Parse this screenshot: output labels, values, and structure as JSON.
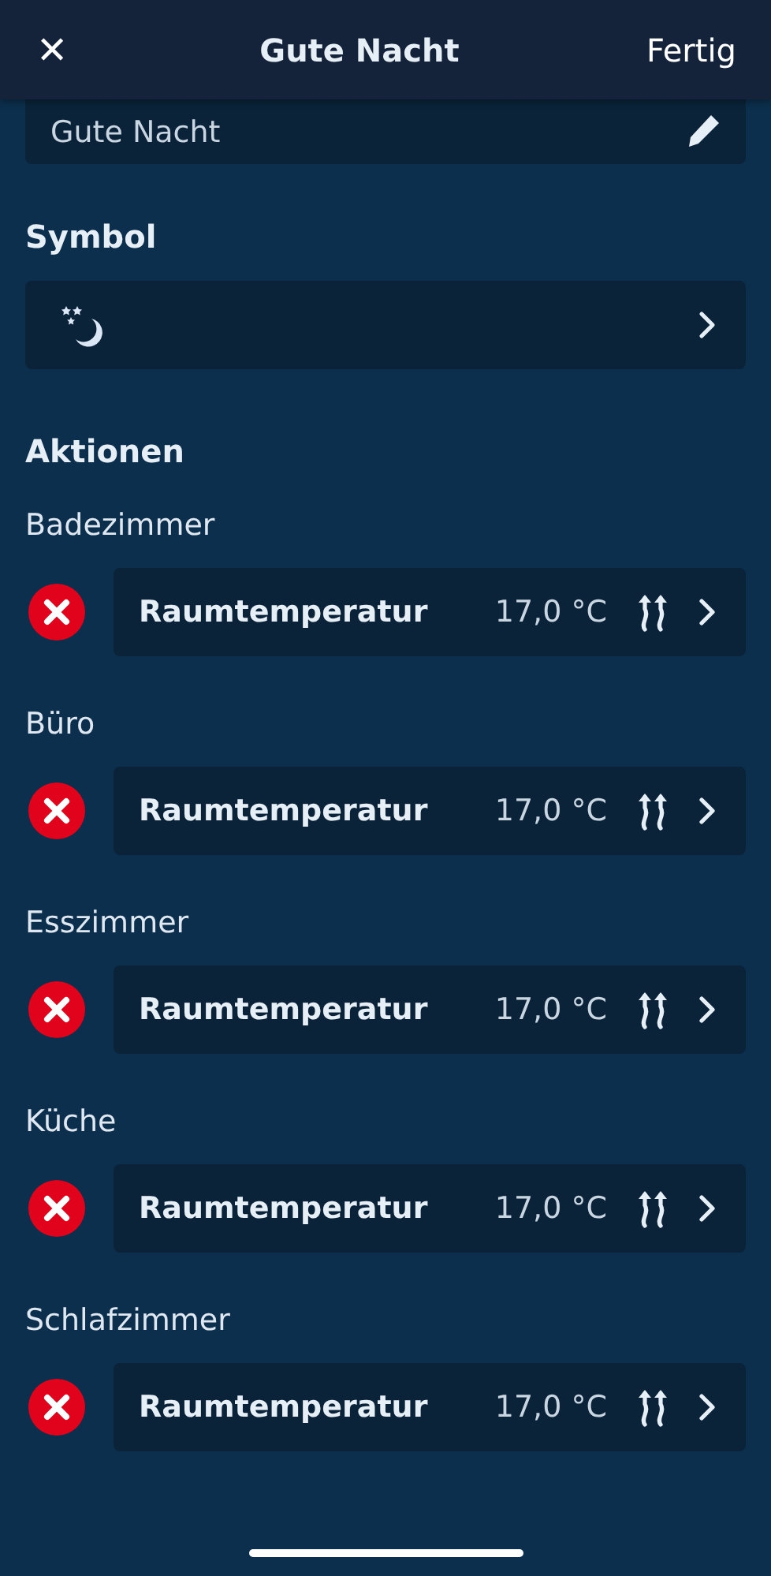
{
  "header": {
    "close": "✕",
    "title": "Gute Nacht",
    "done": "Fertig"
  },
  "name_field": {
    "value": "Gute Nacht"
  },
  "symbol_section": {
    "label": "Symbol"
  },
  "actions_section": {
    "label": "Aktionen"
  },
  "actions": [
    {
      "room": "Badezimmer",
      "action": "Raumtemperatur",
      "value": "17,0 °C"
    },
    {
      "room": "Büro",
      "action": "Raumtemperatur",
      "value": "17,0 °C"
    },
    {
      "room": "Esszimmer",
      "action": "Raumtemperatur",
      "value": "17,0 °C"
    },
    {
      "room": "Küche",
      "action": "Raumtemperatur",
      "value": "17,0 °C"
    },
    {
      "room": "Schlafzimmer",
      "action": "Raumtemperatur",
      "value": "17,0 °C"
    }
  ]
}
